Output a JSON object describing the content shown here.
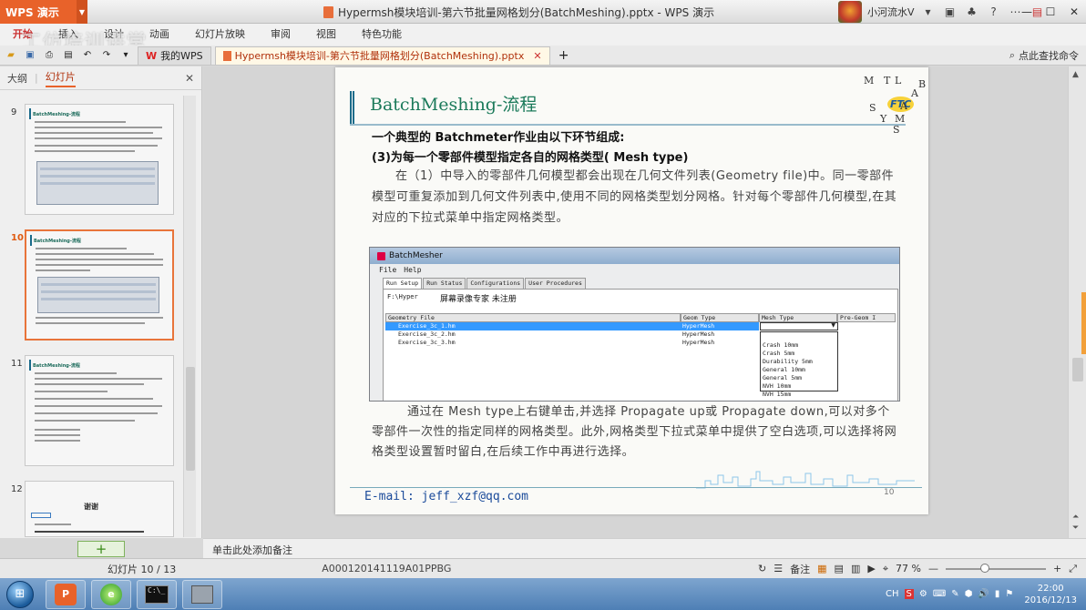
{
  "window": {
    "app_button": "WPS 演示",
    "title": "Hypermsh模块培训-第六节批量网格划分(BatchMeshing).pptx - WPS 演示",
    "user": "小河流水V"
  },
  "watermark": "工仿培训讲堂",
  "menu": [
    "开始",
    "插入",
    "设计",
    "动画",
    "幻灯片放映",
    "审阅",
    "视图",
    "特色功能"
  ],
  "tabs": {
    "home_tab": "我的WPS",
    "doc_tab": "Hypermsh模块培训-第六节批量网格划分(BatchMeshing).pptx"
  },
  "find_command": "点此查找命令",
  "left_panel": {
    "tab_outline": "大纲",
    "tab_slides": "幻灯片",
    "thumbs": [
      {
        "num": "9",
        "title": "BatchMeshing-流程"
      },
      {
        "num": "10",
        "title": "BatchMeshing-流程"
      },
      {
        "num": "11",
        "title": "BatchMeshing-流程"
      },
      {
        "num": "12",
        "title": "谢谢"
      }
    ]
  },
  "slide": {
    "title": "BatchMeshing-流程",
    "logo_letters": [
      "M",
      "T",
      "L",
      "A",
      "B",
      "FTC",
      "S",
      "Y",
      "M",
      "A",
      "S"
    ],
    "heading": "一个典型的 Batchmeter作业由以下环节组成:",
    "subheading": "(3)为每一个零部件模型指定各自的网格类型( Mesh type)",
    "para1": "在（1）中导入的零部件几何模型都会出现在几何文件列表(Geometry file)中。同一零部件模型可重复添加到几何文件列表中,使用不同的网格类型划分网格。针对每个零部件几何模型,在其对应的下拉式菜单中指定网格类型。",
    "para2": "通过在 Mesh type上右键单击,并选择 Propagate up或 Propagate down,可以对多个零部件一次性的指定同样的网格类型。此外,网格类型下拉式菜单中提供了空白选项,可以选择将网格类型设置暂时留白,在后续工作中再进行选择。",
    "email": "E-mail: jeff_xzf@qq.com",
    "page_number": "10"
  },
  "batchmesher": {
    "window_title": "BatchMesher",
    "menu": [
      "File",
      "Help"
    ],
    "tabs": [
      "Run Setup",
      "Run Status",
      "Configurations",
      "User Procedures"
    ],
    "path_prefix": "F:\\Hyper",
    "recorder_text": "屏幕录像专家 未注册",
    "columns": [
      "Geometry File",
      "Geom Type",
      "Mesh Type",
      "Pre-Geom I"
    ],
    "rows": [
      {
        "file": "Exercise_3c_1.hm",
        "geom": "HyperMesh",
        "selected": true
      },
      {
        "file": "Exercise_3c_2.hm",
        "geom": "HyperMesh",
        "selected": false
      },
      {
        "file": "Exercise_3c_3.hm",
        "geom": "HyperMesh",
        "selected": false
      }
    ],
    "dropdown_options": [
      "Crash 10mm",
      "Crash 5mm",
      "Durability 5mm",
      "General 10mm",
      "General 5mm",
      "NVH 10mm",
      "NVH 15mm"
    ]
  },
  "notes_placeholder": "单击此处添加备注",
  "status": {
    "slide_info": "幻灯片 10 / 13",
    "note_code": "A000120141119A01PPBG",
    "notes_label": "备注",
    "zoom": "77 %"
  },
  "taskbar": {
    "lang": "CH",
    "time": "22:00",
    "date": "2016/12/13"
  },
  "colors": {
    "wps_orange": "#e8622a",
    "title_green": "#1b7a5a",
    "selection_blue": "#3399ff"
  }
}
